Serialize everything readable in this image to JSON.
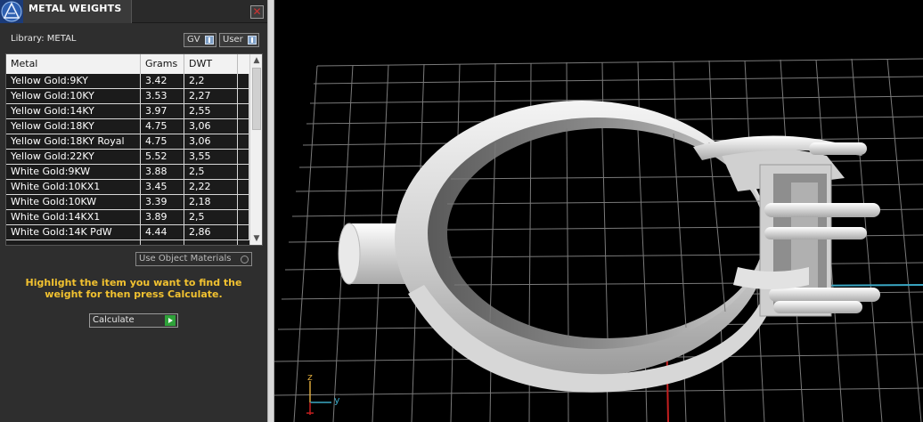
{
  "window": {
    "title": "METAL WEIGHTS",
    "close_glyph": "✕"
  },
  "library": {
    "label": "Library: METAL",
    "gv_label": "GV",
    "user_label": "User"
  },
  "table": {
    "headers": [
      "Metal",
      "Grams",
      "DWT"
    ],
    "rows": [
      [
        "Yellow Gold:9KY",
        "3.42",
        "2,2"
      ],
      [
        "Yellow Gold:10KY",
        "3.53",
        "2,27"
      ],
      [
        "Yellow Gold:14KY",
        "3.97",
        "2,55"
      ],
      [
        "Yellow Gold:18KY",
        "4.75",
        "3,06"
      ],
      [
        "Yellow Gold:18KY Royal",
        "4.75",
        "3,06"
      ],
      [
        "Yellow Gold:22KY",
        "5.52",
        "3,55"
      ],
      [
        "White Gold:9KW",
        "3.88",
        "2,5"
      ],
      [
        "White Gold:10KX1",
        "3.45",
        "2,22"
      ],
      [
        "White Gold:10KW",
        "3.39",
        "2,18"
      ],
      [
        "White Gold:14KX1",
        "3.89",
        "2,5"
      ],
      [
        "White Gold:14K PdW",
        "4.44",
        "2,86"
      ]
    ]
  },
  "options": {
    "use_object_materials": "Use Object Materials"
  },
  "instructions": "Highlight the item you want to find the weight for then press Calculate.",
  "calculate_label": "Calculate",
  "viewport": {
    "axis_z": "z",
    "axis_y": "y"
  },
  "colors": {
    "accent_text": "#f2c230",
    "panel_bg": "#2e2e2e",
    "grid_line": "#7a7a7a"
  }
}
